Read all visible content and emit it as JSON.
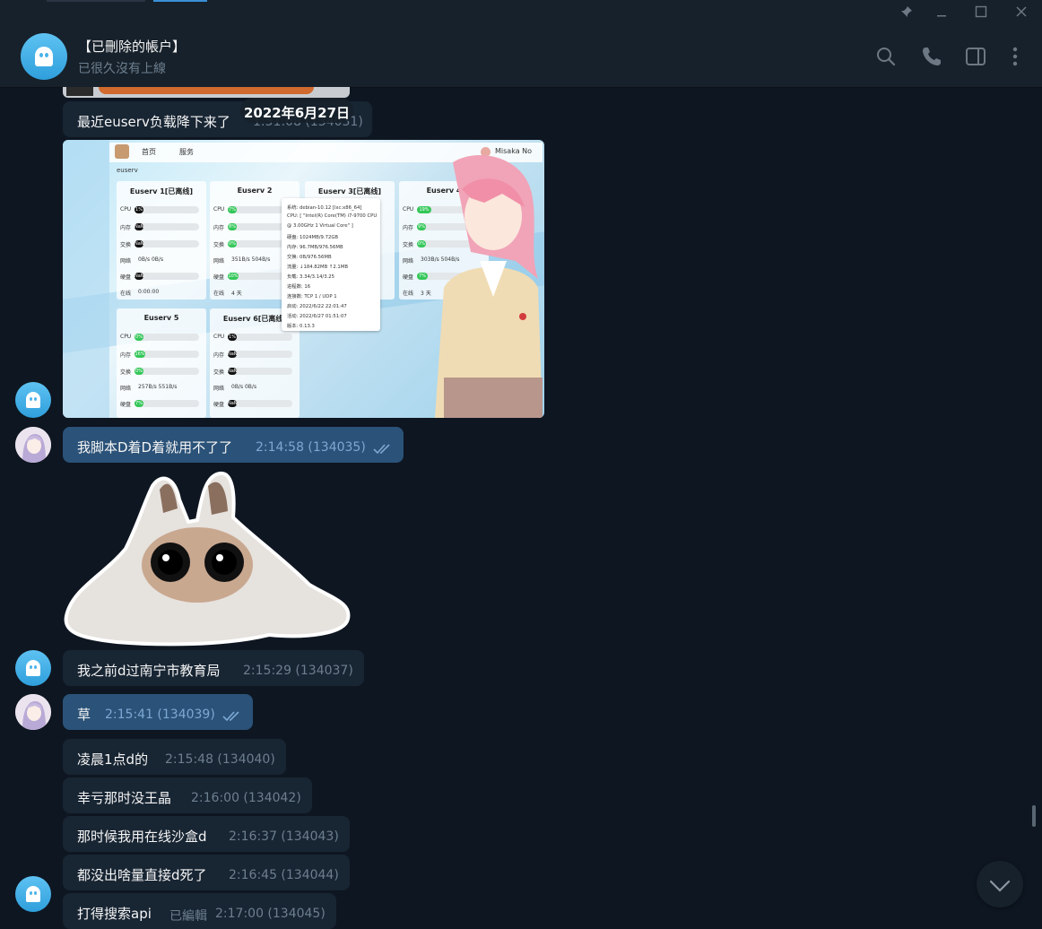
{
  "window": {
    "controls": [
      "pin-icon",
      "minimize-icon",
      "maximize-icon",
      "close-icon"
    ]
  },
  "header": {
    "title": "【已刪除的帳户】",
    "status": "已很久沒有上線",
    "icons": [
      "search-icon",
      "phone-icon",
      "sidebar-toggle-icon",
      "more-icon"
    ]
  },
  "date_separator": "2022年6月27日",
  "screenshot": {
    "nav_home": "首页",
    "nav_service": "服务",
    "user": "Misaka No",
    "group": "euserv",
    "cards": [
      {
        "title": "Euserv 1[已离线]",
        "cpu": "1%",
        "mem": "NaN",
        "swap": "NaN",
        "net": "0B/s  0B/s",
        "disk": "NaN",
        "online": "0:00:00"
      },
      {
        "title": "Euserv 2",
        "cpu": "7%",
        "mem": "8%",
        "swap": "0%",
        "net": "351B/s  504B/s",
        "disk": "10%",
        "online": "4 天"
      },
      {
        "title": "Euserv 3[已离线]"
      },
      {
        "title": "Euserv 4",
        "cpu": "19%",
        "mem": "9%",
        "swap": "0%",
        "net": "303B/s  504B/s",
        "disk": "7%",
        "online": "3 天"
      },
      {
        "title": "Euserv 5",
        "cpu": "0%",
        "mem": "16%",
        "swap": "0%",
        "net": "257B/s  551B/s",
        "disk": "7%"
      },
      {
        "title": "Euserv 6[已离线]",
        "cpu": "1%",
        "mem": "NaN",
        "swap": "NaN",
        "net": "0B/s  0B/s",
        "disk": "NaN"
      }
    ],
    "labels": {
      "cpu": "CPU",
      "mem": "内存",
      "swap": "交换",
      "net": "网络",
      "disk": "硬盘",
      "online": "在线"
    },
    "tooltip": [
      "系统: debian-10.12 [lxc:x86_64]",
      "CPU: [ \"Intel(R) Core(TM) i7-9700 CPU",
      "@ 3.00GHz 1 Virtual Core\" ]",
      "硬盘: 1024MB/9.72GB",
      "内存: 96.7MB/976.56MB",
      "交换: 0B/976.56MB",
      "流量: ↓184.82MB ↑2.1MB",
      "负载: 3.34/3.14/3.25",
      "进程数: 16",
      "连接数: TCP 1 / UDP 1",
      "启动: 2022/6/22 22:01:47",
      "活动: 2022/6/27 01:51:07",
      "版本: 0.13.3"
    ]
  },
  "messages": [
    {
      "text": "最近euserv负载降下来了",
      "time": "1:51:08 (134031)"
    },
    {
      "text": "我脚本D着D着就用不了了",
      "time": "2:14:58 (134035)"
    },
    {
      "text": "我之前d过南宁市教育局",
      "time": "2:15:29 (134037)"
    },
    {
      "text": "草",
      "time": "2:15:41 (134039)"
    },
    {
      "text": "凌晨1点d的",
      "time": "2:15:48 (134040)"
    },
    {
      "text": "幸亏那时没王晶",
      "time": "2:16:00 (134042)"
    },
    {
      "text": "那时候我用在线沙盒d",
      "time": "2:16:37 (134043)"
    },
    {
      "text": "都没出啥量直接d死了",
      "time": "2:16:45 (134044)"
    },
    {
      "text": "打得搜索api",
      "edited": "已編輯",
      "time": "2:17:00 (134045)"
    }
  ],
  "colors": {
    "background": "#0e1621",
    "panel": "#17212b",
    "incoming_bubble": "#182533",
    "outgoing_bubble": "#2b5278",
    "accent": "#4bb3ea"
  }
}
